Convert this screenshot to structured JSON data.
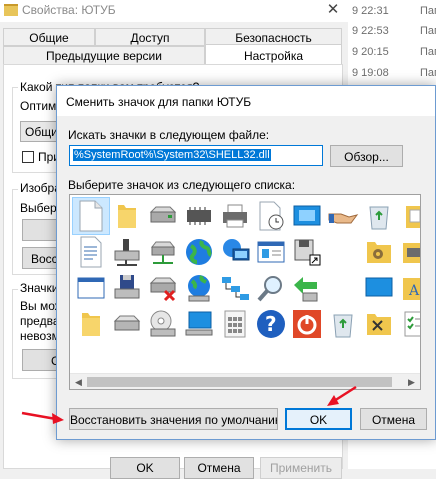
{
  "bg_window": {
    "title": "Свойства: ЮТУБ",
    "tabs_row1": [
      "Общие",
      "Доступ",
      "Безопасность"
    ],
    "tabs_row2": [
      "Предыдущие версии",
      "Настройка"
    ],
    "group1_title": "Какой тип папки вам требуется?",
    "group1_optimize": "Оптими",
    "group1_dropdown": "Общие",
    "group1_checkbox": "При",
    "group2_title": "Изобра",
    "group2_text": "Выбери",
    "group2_restore": "Восст",
    "group3_title": "Значки",
    "group3_text": [
      "Вы мож",
      "предва",
      "невозм"
    ],
    "group3_button": "С",
    "bottom_ok": "OK",
    "bottom_cancel": "Отмена",
    "bottom_apply": "Применить"
  },
  "file_list": [
    {
      "date": "9 22:31",
      "type": "Папк"
    },
    {
      "date": "9 22:53",
      "type": "Папк"
    },
    {
      "date": "9 20:15",
      "type": "Папк"
    },
    {
      "date": "9 19:08",
      "type": "Папк"
    }
  ],
  "dialog": {
    "title": "Сменить значок для папки ЮТУБ",
    "search_label": "Искать значки в следующем файле:",
    "path_value": "%SystemRoot%\\System32\\SHELL32.dll",
    "browse_label": "Обзор...",
    "list_label": "Выберите значок из следующего списка:",
    "restore_label": "Восстановить значения по умолчанию",
    "ok_label": "OK",
    "cancel_label": "Отмена"
  },
  "colors": {
    "accent": "#0078d7",
    "arrow": "#e81123"
  }
}
